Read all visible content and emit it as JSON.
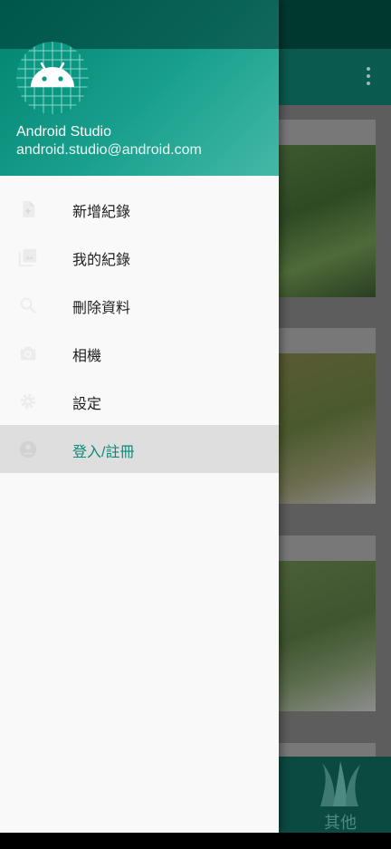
{
  "colors": {
    "accent": "#0a8a77",
    "header_start": "#00826f",
    "header_end": "#45b8a8",
    "active_item_bg": "#dedede"
  },
  "drawer": {
    "header": {
      "avatar_icon": "android-icon",
      "name": "Android Studio",
      "email": "android.studio@android.com"
    },
    "items": [
      {
        "label": "新增紀錄",
        "icon": "note-add-icon",
        "active": false
      },
      {
        "label": "我的紀錄",
        "icon": "photo-library-icon",
        "active": false
      },
      {
        "label": "刪除資料",
        "icon": "search-icon",
        "active": false
      },
      {
        "label": "相機",
        "icon": "camera-icon",
        "active": false
      },
      {
        "label": "設定",
        "icon": "settings-icon",
        "active": false
      },
      {
        "label": "登入/註冊",
        "icon": "account-circle-icon",
        "active": true
      }
    ]
  },
  "background_app": {
    "bottom_nav": {
      "label": "其他",
      "icon": "grass-icon"
    }
  }
}
